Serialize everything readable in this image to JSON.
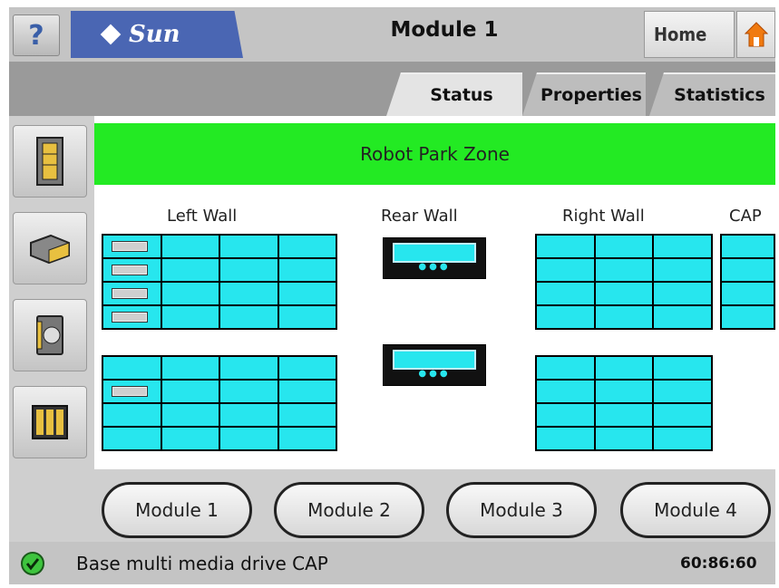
{
  "header": {
    "help_label": "?",
    "logo_text": "Sun",
    "title": "Module 1",
    "home_label": "Home"
  },
  "tabs": [
    {
      "label": "Status",
      "active": true
    },
    {
      "label": "Properties",
      "active": false
    },
    {
      "label": "Statistics",
      "active": false
    }
  ],
  "side_buttons": [
    {
      "icon": "library-tower-icon"
    },
    {
      "icon": "tape-drive-icon"
    },
    {
      "icon": "cartridge-icon"
    },
    {
      "icon": "storage-cells-icon"
    }
  ],
  "zone": {
    "label": "Robot Park Zone",
    "color": "#23ea23"
  },
  "walls": {
    "left": "Left Wall",
    "rear": "Rear Wall",
    "right": "Right Wall",
    "cap": "CAP"
  },
  "modules": [
    {
      "label": "Module 1"
    },
    {
      "label": "Module 2"
    },
    {
      "label": "Module 3"
    },
    {
      "label": "Module 4"
    }
  ],
  "status": {
    "icon": "check-ok-icon",
    "message": "Base multi media drive CAP",
    "time": "60:86:60"
  },
  "colors": {
    "cell": "#27e6ee",
    "logo": "#4a66b3"
  }
}
